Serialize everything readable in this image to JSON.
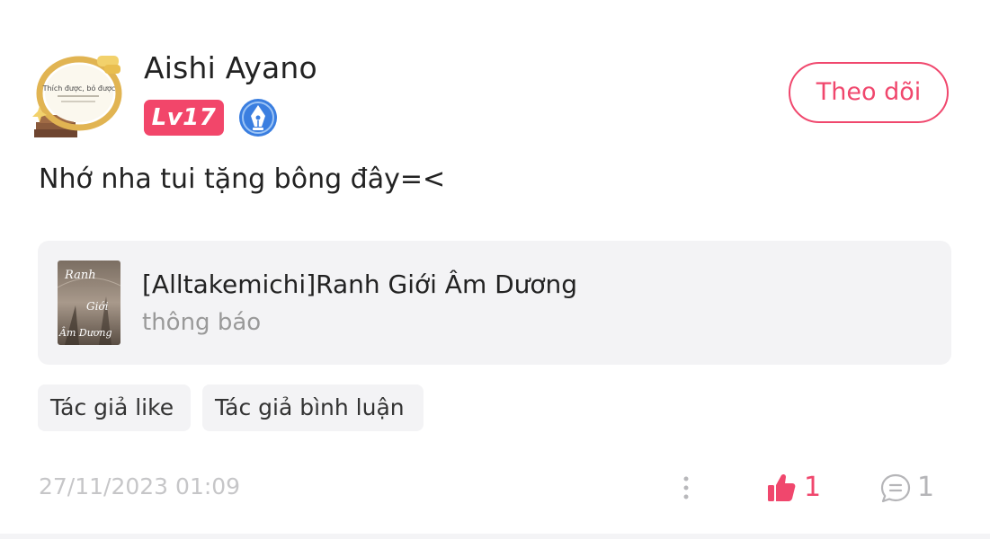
{
  "post": {
    "author": {
      "name": "Aishi Ayano",
      "level": "Lv17",
      "avatar_caption": "Thích được, bỏ được",
      "pen_badge_icon": "fountain-pen-icon"
    },
    "follow_label": "Theo dõi",
    "text": "Nhớ nha tui tặng bông đây=<",
    "story": {
      "title": "[Alltakemichi]Ranh Giới Âm Dương",
      "subtitle": "thông báo",
      "cover_text": [
        "Ranh",
        "Giới",
        "Âm Dương"
      ]
    },
    "tags": [
      "Tác giả like",
      "Tác giả bình luận"
    ],
    "timestamp": "27/11/2023 01:09",
    "likes": "1",
    "comments": "1"
  },
  "colors": {
    "accent": "#f0476d",
    "level_badge": "#f2466a",
    "pen_badge": "#3a7ee0",
    "card_bg": "#f3f3f5",
    "muted_text": "#999999",
    "timestamp_text": "#c6c6c8"
  },
  "icons": {
    "more": "vertical-dots-icon",
    "like": "thumbs-up-icon",
    "comment": "comment-bubble-icon"
  }
}
